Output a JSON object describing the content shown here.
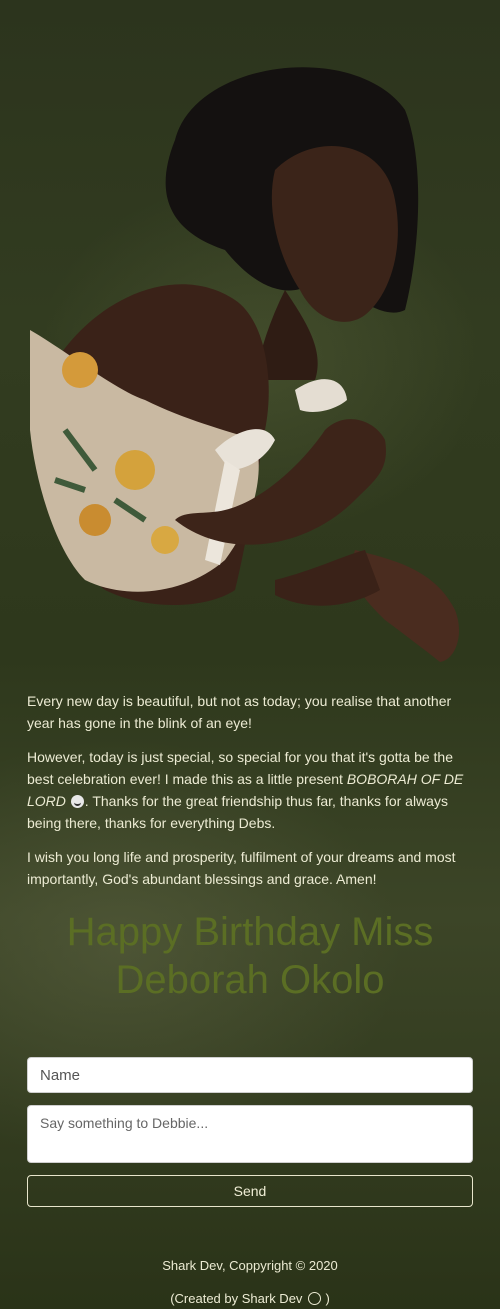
{
  "paragraphs": {
    "p1": "Every new day is beautiful, but not as today; you realise that another year has gone in the blink of an eye!",
    "p2_before": "However, today is just special, so special for you that it's gotta be the best celebration ever! I made this as a little present ",
    "p2_em": "BOBORAH OF DE LORD",
    "p2_after": ". Thanks for the great friendship thus far, thanks for always being there, thanks for everything Debs.",
    "p3": "I wish you long life and prosperity, fulfilment of your dreams and most importantly, God's abundant blessings and grace. Amen!"
  },
  "headline": "Happy Birthday Miss Deborah Okolo",
  "form": {
    "name_placeholder": "Name",
    "message_placeholder": "Say something to Debbie...",
    "send_label": "Send"
  },
  "footer": {
    "copyright": "Shark Dev, Coppyright © 2020",
    "created_prefix": "(Created by Shark Dev",
    "created_suffix": ")"
  },
  "icons": {
    "smile": "smiling-face-icon",
    "whatsapp": "whatsapp-icon"
  },
  "colors": {
    "headline": "#5b6e24",
    "background": "#2e381c"
  }
}
